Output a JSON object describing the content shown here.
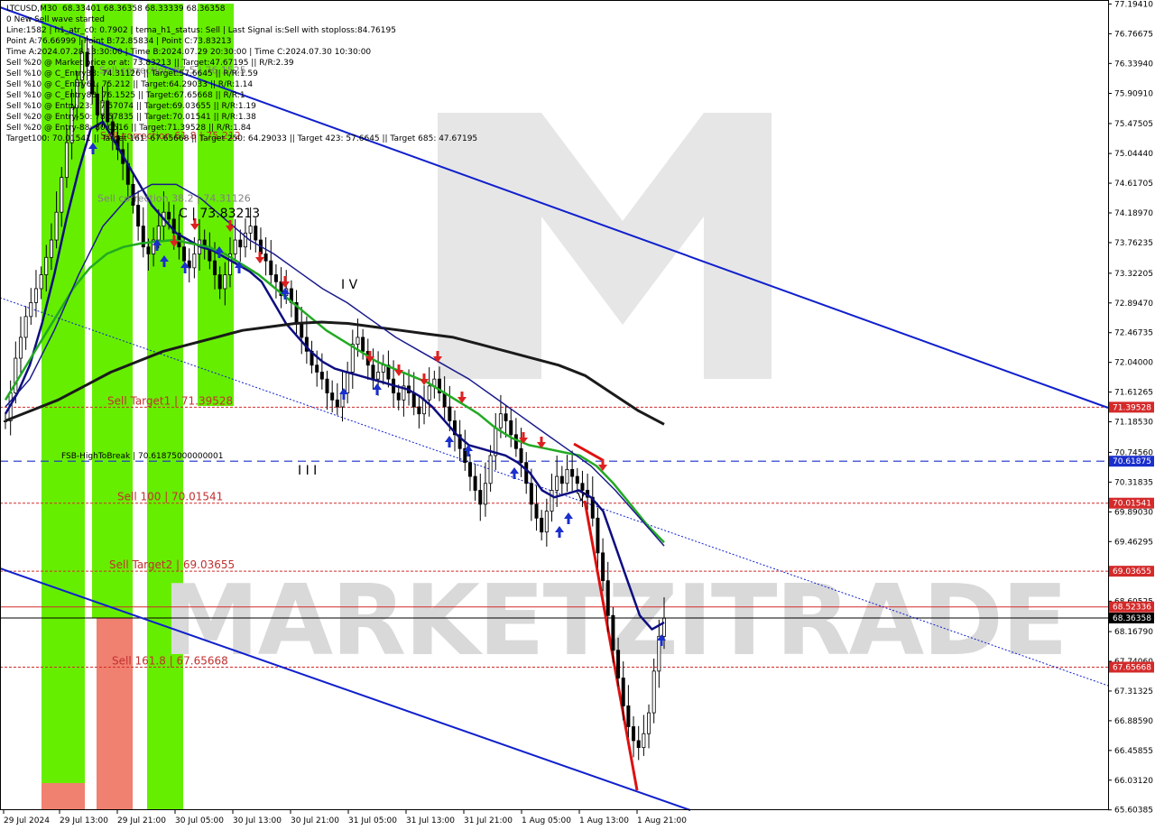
{
  "chart_data": {
    "type": "candlestick",
    "symbol": "LTCUSD",
    "timeframe": "M30",
    "ohlc_header": [
      "68.33401",
      "68.36358",
      "68.33339",
      "68.36358"
    ],
    "info_lines": [
      "LTCUSD,M30  68.33401 68.36358 68.33339 68.36358",
      "0 New Sell wave started",
      "Line:1582 | h1_atr_c0: 0.7902 | tema_h1_status: Sell | Last Signal is:Sell with stoploss:84.76195",
      "Point A:76.66999 | Point B:72.85834 | Point C:73.83213",
      "Time A:2024.07.28 13:30:00 | Time B:2024.07.29 20:30:00 | Time C:2024.07.30 10:30:00",
      "Sell %20 @ Market price or at: 73.83213 || Target:47.67195 || R/R:2.39",
      "Sell %10 @ C_Entry38: 74.31126 || Target:57.6645 || R/R:1.59",
      "Sell %10 @ C_Entry61: 75.212 || Target:64.29033 || R/R:1.14",
      "Sell %10 @ C_Entry88: 76.1525 || Target:67.65668 || R/R:1",
      "Sell %10 @ Entry-23: 77.57074 || Target:69.03655 || R/R:1.19",
      "Sell %20 @ Entry-50: 78.57835 || Target:70.01541 || R/R:1.38",
      "Sell %20 @ Entry-88: 80.0516 || Target:71.39528 || R/R:1.84",
      "Target100: 70.01541 || Target 161: 67.65668 || Target 250: 64.29033 || Target 423: 57.6645 || Target 685: 47.67195"
    ],
    "ylim": [
      65.6,
      77.2
    ],
    "y_ticks": [
      "77.19410",
      "76.76675",
      "76.33940",
      "75.90910",
      "75.47505",
      "75.04440",
      "74.61705",
      "74.18970",
      "73.76235",
      "73.32205",
      "72.89470",
      "72.46735",
      "72.04000",
      "71.61265",
      "71.18530",
      "70.74560",
      "70.31835",
      "69.89030",
      "69.46295",
      "69.03560",
      "68.60525",
      "68.16790",
      "67.74060",
      "67.31325",
      "66.88590",
      "66.45855",
      "66.03120",
      "65.60385"
    ],
    "x_ticks": [
      "29 Jul 2024",
      "29 Jul 13:00",
      "29 Jul 21:00",
      "30 Jul 05:00",
      "30 Jul 13:00",
      "30 Jul 21:00",
      "31 Jul 05:00",
      "31 Jul 13:00",
      "31 Jul 21:00",
      "1 Aug 05:00",
      "1 Aug 13:00",
      "1 Aug 21:00"
    ],
    "price_tags": [
      {
        "label": "71.39528",
        "value": 71.39528,
        "color": "#d42a2a"
      },
      {
        "label": "70.61875",
        "value": 70.61875,
        "color": "#1a2fcc"
      },
      {
        "label": "70.01541",
        "value": 70.01541,
        "color": "#d42a2a"
      },
      {
        "label": "69.03655",
        "value": 69.03655,
        "color": "#d42a2a"
      },
      {
        "label": "68.52336",
        "value": 68.52336,
        "color": "#d42a2a"
      },
      {
        "label": "68.36358",
        "value": 68.36358,
        "color": "#000000"
      },
      {
        "label": "67.65668",
        "value": 67.65668,
        "color": "#d42a2a"
      }
    ],
    "level_labels": [
      {
        "text": "Sell Target1 | 71.39528",
        "value": 71.39528
      },
      {
        "text": "FSB-HighToBreak | 70.61875000000001",
        "value": 70.61875
      },
      {
        "text": "Sell 100 | 70.01541",
        "value": 70.01541
      },
      {
        "text": "Sell Target2 | 69.03655",
        "value": 69.03655
      },
      {
        "text": "Sell 161.8 | 67.65668",
        "value": 67.65668
      },
      {
        "text": "Sell correction 61.8 | 75.212",
        "value": 75.212
      },
      {
        "text": "Sell correction 38.2 | 74.31126",
        "value": 74.31126
      },
      {
        "text": "Sell correction 87.5 | 76.1525",
        "value": 76.1525
      }
    ],
    "wave_labels": [
      "I V",
      "I I I",
      "V",
      "C | 73.83213"
    ],
    "watermark": "MARKETZITRADE",
    "colors": {
      "bull_candle": "#000000",
      "bear_candle": "#000000",
      "fast_ma": "#0d0d80",
      "mid_ma": "#22aa22",
      "slow_ma": "#1a1a1a",
      "ma_outer": "#1a1a8c",
      "channel": "#1020cc",
      "red_level": "#c23030",
      "fsb_line": "#1a2fcc",
      "green_zone": "#66ee00",
      "red_zone": "#f08070",
      "signal_up": "#1a2fcc",
      "signal_down": "#dd2020"
    },
    "series": [
      {
        "name": "price",
        "values": [
          71.2,
          71.6,
          72.1,
          72.4,
          72.7,
          72.9,
          73.1,
          73.3,
          73.55,
          73.8,
          74.2,
          74.7,
          75.2,
          75.7,
          76.1,
          76.5,
          76.3,
          75.9,
          75.6,
          75.8,
          75.5,
          75.3,
          75.1,
          74.9,
          74.6,
          74.3,
          74.0,
          73.7,
          73.6,
          73.8,
          74.0,
          74.2,
          74.1,
          73.9,
          73.7,
          73.5,
          73.4,
          73.6,
          73.8,
          73.7,
          73.5,
          73.3,
          73.1,
          73.3,
          73.6,
          73.8,
          73.7,
          73.9,
          74.0,
          73.8,
          73.6,
          73.5,
          73.3,
          73.2,
          73.0,
          73.1,
          72.9,
          72.6,
          72.4,
          72.2,
          72.0,
          71.9,
          71.8,
          71.6,
          71.5,
          71.4,
          71.6,
          71.9,
          72.3,
          72.4,
          72.2,
          72.0,
          71.8,
          71.9,
          72.0,
          71.8,
          71.6,
          71.5,
          71.7,
          71.6,
          71.4,
          71.3,
          71.5,
          71.7,
          71.8,
          71.6,
          71.4,
          71.2,
          71.0,
          70.8,
          70.6,
          70.4,
          70.2,
          70.0,
          70.3,
          70.7,
          71.1,
          71.3,
          71.2,
          71.0,
          70.8,
          70.6,
          70.3,
          70.0,
          69.8,
          69.6,
          69.9,
          70.2,
          70.4,
          70.3,
          70.5,
          70.4,
          70.3,
          70.2,
          70.1,
          69.8,
          69.3,
          68.9,
          68.4,
          67.9,
          67.5,
          67.1,
          66.8,
          66.6,
          66.5,
          66.7,
          67.0,
          67.6,
          68.1,
          68.36
        ]
      },
      {
        "name": "fast_ma",
        "values": [
          71.3,
          71.6,
          72.0,
          72.6,
          73.3,
          74.1,
          74.8,
          75.4,
          75.5,
          75.2,
          74.9,
          74.6,
          74.3,
          74.1,
          73.9,
          73.8,
          73.7,
          73.65,
          73.55,
          73.45,
          73.35,
          73.2,
          72.9,
          72.6,
          72.4,
          72.2,
          72.05,
          71.95,
          71.9,
          71.85,
          71.8,
          71.75,
          71.7,
          71.65,
          71.55,
          71.4,
          71.2,
          71.0,
          70.85,
          70.8,
          70.75,
          70.7,
          70.6,
          70.45,
          70.2,
          70.1,
          70.15,
          70.2,
          70.1,
          69.9,
          69.4,
          68.9,
          68.4,
          68.2,
          68.3
        ]
      },
      {
        "name": "mid_ma",
        "values": [
          71.5,
          71.9,
          72.3,
          72.7,
          73.1,
          73.4,
          73.6,
          73.7,
          73.75,
          73.78,
          73.8,
          73.75,
          73.7,
          73.6,
          73.45,
          73.3,
          73.1,
          72.9,
          72.7,
          72.5,
          72.35,
          72.2,
          72.05,
          71.95,
          71.85,
          71.75,
          71.6,
          71.45,
          71.3,
          71.1,
          70.95,
          70.85,
          70.8,
          70.75,
          70.7,
          70.55,
          70.3,
          70.0,
          69.7,
          69.45
        ]
      },
      {
        "name": "slow_ma",
        "values": [
          71.2,
          71.35,
          71.5,
          71.7,
          71.9,
          72.05,
          72.2,
          72.3,
          72.4,
          72.5,
          72.55,
          72.6,
          72.62,
          72.6,
          72.55,
          72.5,
          72.45,
          72.4,
          72.3,
          72.2,
          72.1,
          72.0,
          71.85,
          71.6,
          71.35,
          71.15
        ]
      },
      {
        "name": "ma_outer",
        "values": [
          71.4,
          71.8,
          72.5,
          73.3,
          74.0,
          74.4,
          74.6,
          74.6,
          74.4,
          74.1,
          73.8,
          73.6,
          73.35,
          73.1,
          72.9,
          72.65,
          72.4,
          72.2,
          72.0,
          71.8,
          71.55,
          71.3,
          71.05,
          70.8,
          70.55,
          70.2,
          69.8,
          69.4
        ]
      }
    ]
  }
}
